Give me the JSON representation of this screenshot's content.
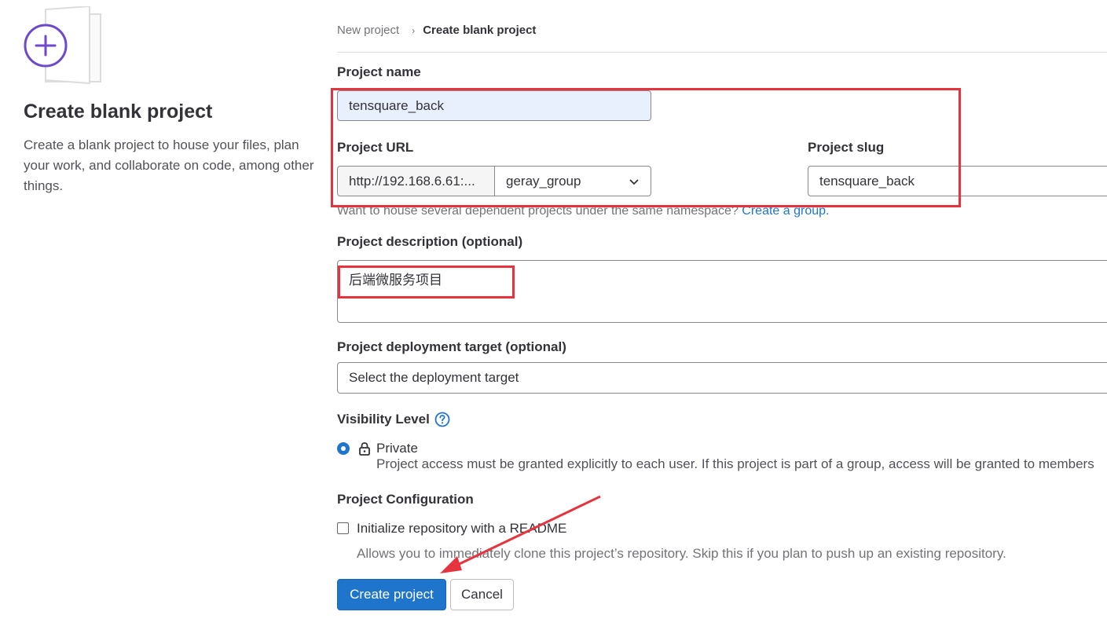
{
  "left": {
    "title": "Create blank project",
    "description": "Create a blank project to house your files, plan your work, and collaborate on code, among other things."
  },
  "breadcrumb": {
    "parent": "New project",
    "current": "Create blank project"
  },
  "form": {
    "project_name_label": "Project name",
    "project_name_value": "tensquare_back",
    "project_url_label": "Project URL",
    "url_prefix": "http://192.168.6.61:...",
    "namespace_value": "geray_group",
    "project_slug_label": "Project slug",
    "project_slug_value": "tensquare_back",
    "namespace_help": "Want to house several dependent projects under the same namespace?",
    "namespace_help_link": "Create a group.",
    "description_label": "Project description (optional)",
    "description_value": "后端微服务项目",
    "deployment_label": "Project deployment target (optional)",
    "deployment_placeholder": "Select the deployment target",
    "visibility_label": "Visibility Level",
    "visibility_option": "Private",
    "visibility_desc": "Project access must be granted explicitly to each user. If this project is part of a group, access will be granted to members",
    "config_label": "Project Configuration",
    "readme_label": "Initialize repository with a README",
    "readme_help": "Allows you to immediately clone this project’s repository. Skip this if you plan to push up an existing repository.",
    "create_button": "Create project",
    "cancel_button": "Cancel"
  },
  "colors": {
    "primary": "#1f75cb",
    "annotation": "#e5343d",
    "accent_purple": "#6e49cb"
  },
  "icons": [
    "plus-circle-icon",
    "chevron-down-icon",
    "question-icon",
    "lock-icon"
  ]
}
